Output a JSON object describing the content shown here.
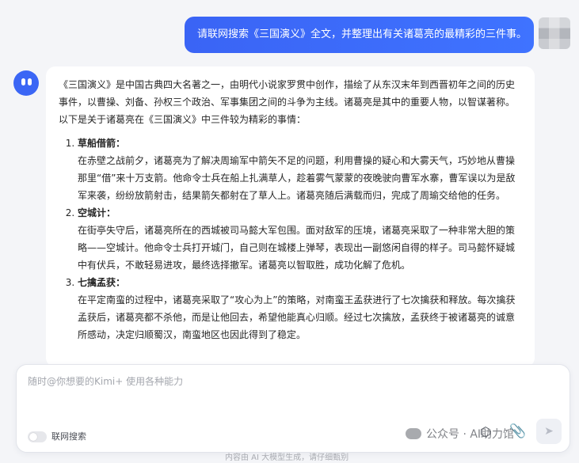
{
  "user_message": "请联网搜索《三国演义》全文，并整理出有关诸葛亮的最精彩的三件事。",
  "assistant": {
    "intro": "《三国演义》是中国古典四大名著之一，由明代小说家罗贯中创作，描绘了从东汉末年到西晋初年之间的历史事件，以曹操、刘备、孙权三个政治、军事集团之间的斗争为主线。诸葛亮是其中的重要人物，以智谋著称。以下是关于诸葛亮在《三国演义》中三件较为精彩的事情：",
    "items": [
      {
        "title": "草船借箭：",
        "body": "在赤壁之战前夕，诸葛亮为了解决周瑜军中箭矢不足的问题，利用曹操的疑心和大雾天气，巧妙地从曹操那里“借”来十万支箭。他命令士兵在船上扎满草人，趁着雾气蒙蒙的夜晚驶向曹军水寨，曹军误以为是敌军来袭，纷纷放箭射击，结果箭矢都射在了草人上。诸葛亮随后满载而归，完成了周瑜交给他的任务。"
      },
      {
        "title": "空城计：",
        "body": "在街亭失守后，诸葛亮所在的西城被司马懿大军包围。面对敌军的压境，诸葛亮采取了一种非常大胆的策略——空城计。他命令士兵打开城门，自己则在城楼上弹琴，表现出一副悠闲自得的样子。司马懿怀疑城中有伏兵，不敢轻易进攻，最终选择撤军。诸葛亮以智取胜，成功化解了危机。"
      },
      {
        "title": "七擒孟获：",
        "body": "在平定南蛮的过程中，诸葛亮采取了“攻心为上”的策略，对南蛮王孟获进行了七次擒获和释放。每次擒获孟获后，诸葛亮都不杀他，而是让他回去，希望他能真心归顺。经过七次擒放，孟获终于被诸葛亮的诚意所感动，决定归顺蜀汉，南蛮地区也因此得到了稳定。"
      }
    ]
  },
  "composer": {
    "placeholder": "随时@你想要的Kimi+ 使用各种能力",
    "web_search_label": "联网搜索",
    "web_search_on": false
  },
  "watermark": "公众号 · AI助力馆",
  "footer_note": "内容由 AI 大模型生成，请仔细甄别",
  "colors": {
    "accent": "#3c6bff",
    "page_bg": "#f4f5f8"
  },
  "icons": {
    "bot_avatar": "kimi-bot-icon",
    "attach": "paperclip-icon",
    "tool": "cube-icon",
    "send": "send-icon"
  }
}
